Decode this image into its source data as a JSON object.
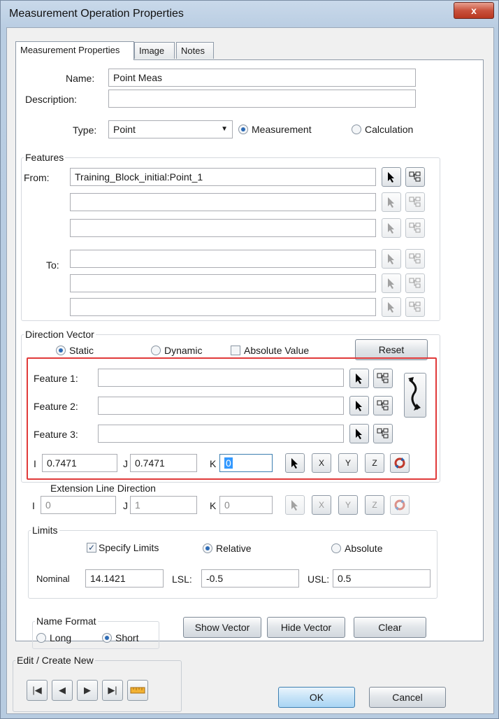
{
  "window": {
    "title": "Measurement Operation Properties",
    "close_label": "x"
  },
  "tabs": [
    "Measurement Properties",
    "Image",
    "Notes"
  ],
  "name": {
    "label": "Name:",
    "value": "Point Meas"
  },
  "description": {
    "label": "Description:",
    "value": ""
  },
  "type": {
    "label": "Type:",
    "value": "Point",
    "option_measurement": "Measurement",
    "option_calculation": "Calculation",
    "selected": "Measurement"
  },
  "features": {
    "title": "Features",
    "from_label": "From:",
    "to_label": "To:",
    "from_values": [
      "Training_Block_initial:Point_1",
      "",
      ""
    ],
    "to_values": [
      "",
      "",
      ""
    ]
  },
  "direction": {
    "title": "Direction Vector",
    "static": "Static",
    "dynamic": "Dynamic",
    "absolute": "Absolute Value",
    "reset": "Reset",
    "feature1": "Feature 1:",
    "feature2": "Feature 2:",
    "feature3": "Feature 3:",
    "i_label": "I",
    "i_value": "0.7471",
    "j_label": "J",
    "j_value": "0.7471",
    "k_label": "K",
    "k_value": "0",
    "x": "X",
    "y": "Y",
    "z": "Z"
  },
  "extension": {
    "title": "Extension Line Direction",
    "i_label": "I",
    "i_value": "0",
    "j_label": "J",
    "j_value": "1",
    "k_label": "K",
    "k_value": "0",
    "x": "X",
    "y": "Y",
    "z": "Z"
  },
  "limits": {
    "title": "Limits",
    "specify": "Specify Limits",
    "relative": "Relative",
    "absolute": "Absolute",
    "nominal_label": "Nominal",
    "nominal_value": "14.1421",
    "lsl_label": "LSL:",
    "lsl_value": "-0.5",
    "usl_label": "USL:",
    "usl_value": "0.5"
  },
  "name_format": {
    "title": "Name Format",
    "long": "Long",
    "short": "Short"
  },
  "buttons": {
    "show_vector": "Show Vector",
    "hide_vector": "Hide Vector",
    "clear": "Clear",
    "ok": "OK",
    "cancel": "Cancel"
  },
  "edit": {
    "title": "Edit / Create New"
  },
  "colors": {
    "highlight_box": "#e03a3a",
    "accent": "#2d6bb5"
  }
}
